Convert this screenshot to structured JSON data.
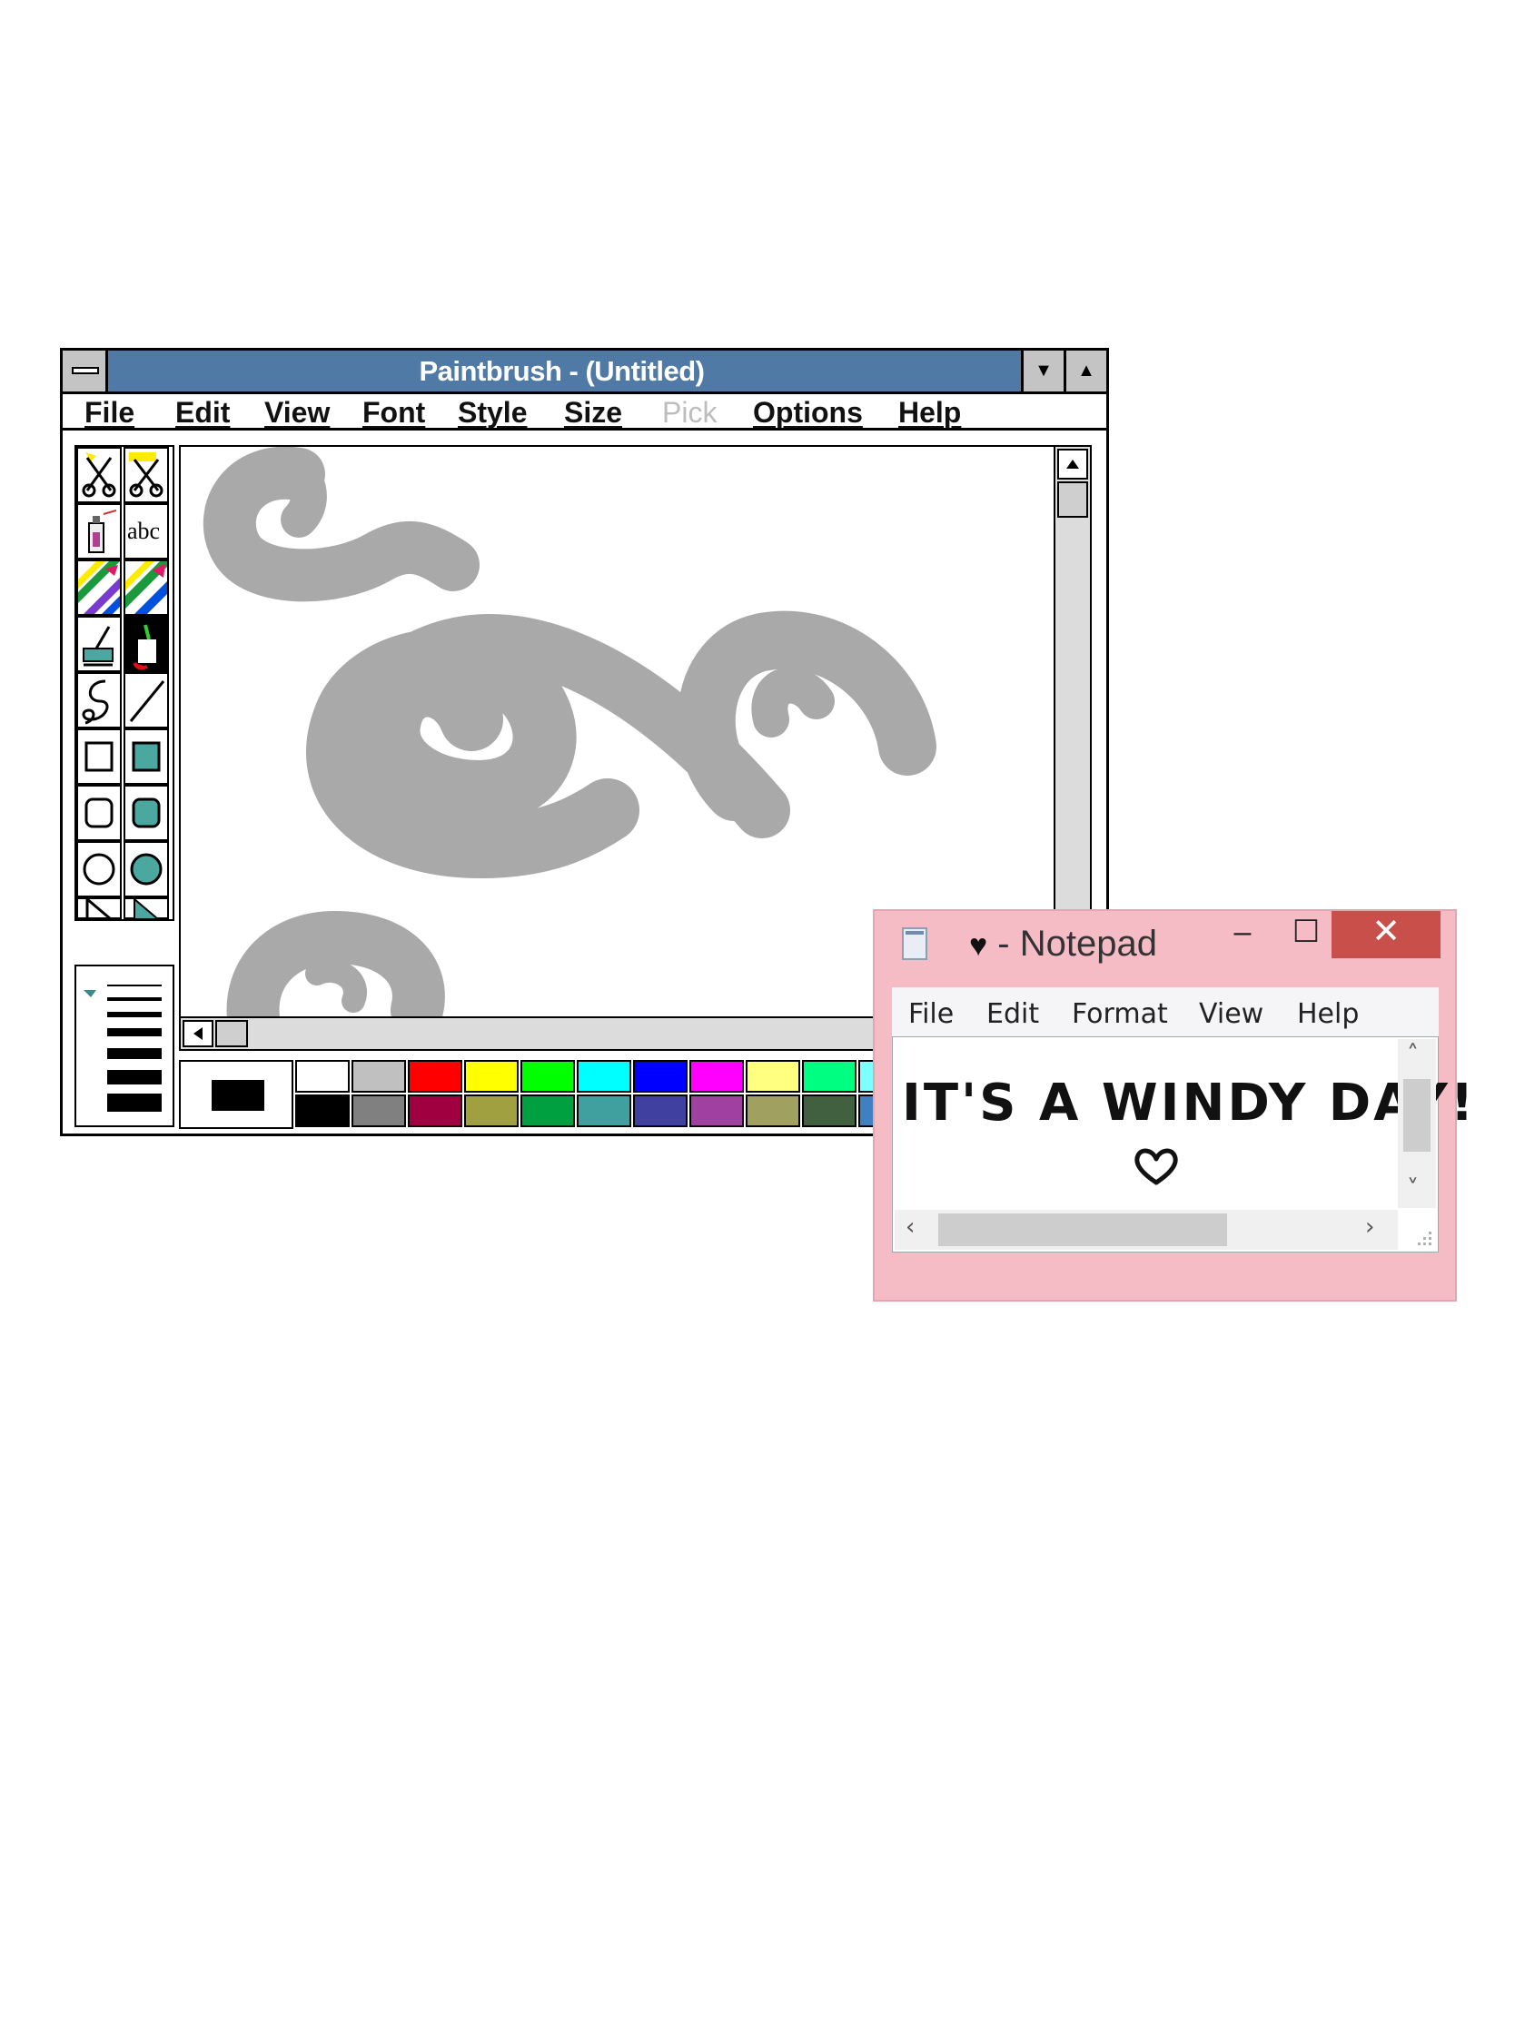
{
  "paintbrush": {
    "title": "Paintbrush - (Untitled)",
    "menu": [
      {
        "label": "File",
        "enabled": true
      },
      {
        "label": "Edit",
        "enabled": true
      },
      {
        "label": "View",
        "enabled": true
      },
      {
        "label": "Font",
        "enabled": true
      },
      {
        "label": "Style",
        "enabled": true
      },
      {
        "label": "Size",
        "enabled": true
      },
      {
        "label": "Pick",
        "enabled": false
      },
      {
        "label": "Options",
        "enabled": true
      },
      {
        "label": "Help",
        "enabled": true
      }
    ],
    "tools": [
      {
        "name": "scissors-icon"
      },
      {
        "name": "pick-scissors-icon"
      },
      {
        "name": "airbrush-icon"
      },
      {
        "name": "text-tool-icon",
        "label": "abc"
      },
      {
        "name": "color-eraser-icon"
      },
      {
        "name": "eraser-icon"
      },
      {
        "name": "paint-roller-icon"
      },
      {
        "name": "brush-icon"
      },
      {
        "name": "curve-icon"
      },
      {
        "name": "line-icon"
      },
      {
        "name": "box-icon"
      },
      {
        "name": "filled-box-icon"
      },
      {
        "name": "rounded-box-icon"
      },
      {
        "name": "filled-rounded-box-icon"
      },
      {
        "name": "circle-icon"
      },
      {
        "name": "filled-circle-icon"
      },
      {
        "name": "polygon-icon"
      },
      {
        "name": "filled-polygon-icon"
      }
    ],
    "palette_top": [
      "#ffffff",
      "#c0c0c0",
      "#ff0000",
      "#ffff00",
      "#00ff00",
      "#00ffff",
      "#0000ff",
      "#ff00ff",
      "#ffff80",
      "#00ff80",
      "#80ffff"
    ],
    "palette_bottom": [
      "#000000",
      "#808080",
      "#a00040",
      "#a0a040",
      "#00a040",
      "#40a0a0",
      "#4040a0",
      "#a040a0",
      "#a0a060",
      "#406040",
      "#4080c0"
    ],
    "foreground_color": "#000000",
    "canvas": {
      "stroke_color": "#a9a9a9",
      "drawing": "gray wind swirl brush strokes"
    }
  },
  "notepad": {
    "title_heart": "♥",
    "title": " - Notepad",
    "controls": {
      "minimize": "–",
      "maximize": "☐",
      "close": "✕"
    },
    "menu": [
      "File",
      "Edit",
      "Format",
      "View",
      "Help"
    ],
    "content": "IT'S A WINDY DAY!",
    "frame_color": "#f6bcc6",
    "close_color": "#c9504a"
  }
}
